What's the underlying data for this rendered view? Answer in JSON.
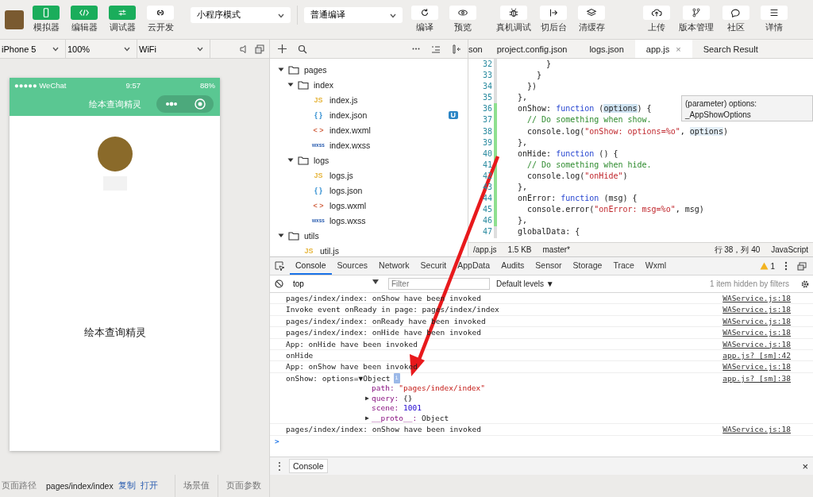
{
  "toolbar": {
    "left_buttons": [
      {
        "label": "模拟器",
        "on": true
      },
      {
        "label": "编辑器",
        "on": true
      },
      {
        "label": "调试器",
        "on": true
      },
      {
        "label": "云开发",
        "on": false
      }
    ],
    "mode_select": {
      "value": "小程序模式"
    },
    "compile_select": {
      "value": "普通编译"
    },
    "actions": [
      {
        "label": "编译"
      },
      {
        "label": "预览"
      },
      {
        "label": "真机调试"
      },
      {
        "label": "切后台"
      },
      {
        "label": "清缓存"
      },
      {
        "label": "上传"
      },
      {
        "label": "版本管理"
      },
      {
        "label": "社区"
      },
      {
        "label": "详情"
      }
    ]
  },
  "device_bar": {
    "device": "iPhone 5",
    "zoom": "100%",
    "network": "WiFi"
  },
  "simulator": {
    "status_bar": {
      "carrier": "●●●●● WeChat",
      "time": "9:57",
      "battery": "88%"
    },
    "nav_title": "绘本查询精灵",
    "page_text": "绘本查询精灵"
  },
  "file_tree": [
    {
      "name": "pages",
      "kind": "folder",
      "expanded": true,
      "children": [
        {
          "name": "index",
          "kind": "folder",
          "expanded": true,
          "children": [
            {
              "name": "index.js",
              "kind": "js",
              "icon_text": "JS"
            },
            {
              "name": "index.json",
              "kind": "json",
              "icon_text": "{ }",
              "badge": "U"
            },
            {
              "name": "index.wxml",
              "kind": "wxml",
              "icon_text": "< >"
            },
            {
              "name": "index.wxss",
              "kind": "wxss",
              "icon_text": "wxss"
            }
          ]
        },
        {
          "name": "logs",
          "kind": "folder",
          "expanded": true,
          "children": [
            {
              "name": "logs.js",
              "kind": "js",
              "icon_text": "JS"
            },
            {
              "name": "logs.json",
              "kind": "json",
              "icon_text": "{ }"
            },
            {
              "name": "logs.wxml",
              "kind": "wxml",
              "icon_text": "< >"
            },
            {
              "name": "logs.wxss",
              "kind": "wxss",
              "icon_text": "wxss"
            }
          ]
        }
      ]
    },
    {
      "name": "utils",
      "kind": "folder",
      "expanded": true,
      "children": [
        {
          "name": "util.js",
          "kind": "js",
          "icon_text": "JS"
        }
      ]
    }
  ],
  "editor": {
    "tabs": [
      {
        "label": "son",
        "selected": false
      },
      {
        "label": "project.config.json",
        "selected": false
      },
      {
        "label": "logs.json",
        "selected": false
      },
      {
        "label": "app.js",
        "selected": true,
        "close": "×"
      },
      {
        "label": "Search Result",
        "selected": false
      }
    ],
    "lines": [
      {
        "number": "32",
        "modified": false,
        "tokens": [
          {
            "text": "      }",
            "kind": "plain"
          }
        ]
      },
      {
        "number": "33",
        "modified": false,
        "tokens": [
          {
            "text": "    }",
            "kind": "plain"
          }
        ]
      },
      {
        "number": "34",
        "modified": false,
        "tokens": [
          {
            "text": "  })",
            "kind": "plain"
          }
        ]
      },
      {
        "number": "35",
        "modified": false,
        "tokens": [
          {
            "text": "},",
            "kind": "plain"
          }
        ]
      },
      {
        "number": "36",
        "modified": true,
        "tokens": [
          {
            "text": "onShow: ",
            "kind": "plain"
          },
          {
            "text": "function",
            "kind": "keyword"
          },
          {
            "text": " (",
            "kind": "plain"
          },
          {
            "text": "options",
            "kind": "match"
          },
          {
            "text": ") {",
            "kind": "plain"
          }
        ]
      },
      {
        "number": "37",
        "modified": true,
        "tokens": [
          {
            "text": "  // Do something when show.",
            "kind": "comment"
          }
        ]
      },
      {
        "number": "38",
        "modified": true,
        "tokens": [
          {
            "text": "  console.log(",
            "kind": "plain"
          },
          {
            "text": "\"onShow: options=%o\"",
            "kind": "string"
          },
          {
            "text": ", ",
            "kind": "plain"
          },
          {
            "text": "options",
            "kind": "hover"
          },
          {
            "text": ")",
            "kind": "plain"
          }
        ]
      },
      {
        "number": "39",
        "modified": true,
        "tokens": [
          {
            "text": "},",
            "kind": "plain"
          }
        ]
      },
      {
        "number": "40",
        "modified": true,
        "tokens": [
          {
            "text": "onHide: ",
            "kind": "plain"
          },
          {
            "text": "function",
            "kind": "keyword"
          },
          {
            "text": " () {",
            "kind": "plain"
          }
        ]
      },
      {
        "number": "41",
        "modified": true,
        "tokens": [
          {
            "text": "  // Do something when hide.",
            "kind": "comment"
          }
        ]
      },
      {
        "number": "42",
        "modified": true,
        "tokens": [
          {
            "text": "  console.log(",
            "kind": "plain"
          },
          {
            "text": "\"onHide\"",
            "kind": "string"
          },
          {
            "text": ")",
            "kind": "plain"
          }
        ]
      },
      {
        "number": "43",
        "modified": true,
        "tokens": [
          {
            "text": "},",
            "kind": "plain"
          }
        ]
      },
      {
        "number": "44",
        "modified": true,
        "tokens": [
          {
            "text": "onError: ",
            "kind": "plain"
          },
          {
            "text": "function",
            "kind": "keyword"
          },
          {
            "text": " (msg) {",
            "kind": "plain"
          }
        ]
      },
      {
        "number": "45",
        "modified": true,
        "tokens": [
          {
            "text": "  console.error(",
            "kind": "plain"
          },
          {
            "text": "\"onError: msg=%o\"",
            "kind": "string"
          },
          {
            "text": ", msg)",
            "kind": "plain"
          }
        ]
      },
      {
        "number": "46",
        "modified": true,
        "tokens": [
          {
            "text": "},",
            "kind": "plain"
          }
        ]
      },
      {
        "number": "47",
        "modified": false,
        "tokens": [
          {
            "text": "globalData: {",
            "kind": "plain"
          }
        ]
      }
    ],
    "tooltip": {
      "line1": "(parameter) options:",
      "line2": "_AppShowOptions"
    },
    "status_bar": {
      "path": "/app.js",
      "size": "1.5 KB",
      "branch": "master*",
      "position": "行 38，列 40",
      "language": "JavaScript"
    }
  },
  "devtools": {
    "tabs": [
      {
        "label": "Console",
        "selected": true
      },
      {
        "label": "Sources",
        "selected": false
      },
      {
        "label": "Network",
        "selected": false
      },
      {
        "label": "Securit",
        "selected": false
      },
      {
        "label": "AppData",
        "selected": false
      },
      {
        "label": "Audits",
        "selected": false
      },
      {
        "label": "Sensor",
        "selected": false
      },
      {
        "label": "Storage",
        "selected": false
      },
      {
        "label": "Trace",
        "selected": false
      },
      {
        "label": "Wxml",
        "selected": false
      }
    ],
    "warnings": "1",
    "context": "top",
    "filter_placeholder": "Filter",
    "levels": "Default levels ▼",
    "hidden_note": "1 item hidden by filters",
    "logs": [
      {
        "kind": "text",
        "text": "pages/index/index: onShow have been invoked",
        "source": "WAService.js:18"
      },
      {
        "kind": "text",
        "text": "Invoke event onReady in page: pages/index/index",
        "source": "WAService.js:18"
      },
      {
        "kind": "text",
        "text": "pages/index/index: onReady have been invoked",
        "source": "WAService.js:18"
      },
      {
        "kind": "text",
        "text": "pages/index/index: onHide have been invoked",
        "source": "WAService.js:18"
      },
      {
        "kind": "text",
        "text": "App: onHide have been invoked",
        "source": "WAService.js:18"
      },
      {
        "kind": "text",
        "text": "onHide",
        "source": "app.js? [sm]:42"
      },
      {
        "kind": "text",
        "text": "App: onShow have been invoked",
        "source": "WAService.js:18"
      },
      {
        "kind": "object",
        "text": "onShow: options=",
        "toggle": "▼",
        "expanded": true,
        "summary": "Object",
        "info": "i",
        "source": "app.js? [sm]:38",
        "properties": [
          {
            "key": "path:",
            "value": "\"pages/index/index\"",
            "kind": "string"
          },
          {
            "key": "query:",
            "value": "{}",
            "kind": "plain",
            "toggle": "▶"
          },
          {
            "key": "scene:",
            "value": "1001",
            "kind": "number"
          },
          {
            "key": "__proto__:",
            "value": "Object",
            "kind": "plain",
            "toggle": "▶"
          }
        ]
      },
      {
        "kind": "text",
        "text": "pages/index/index: onShow have been invoked",
        "source": "WAService.js:18"
      }
    ],
    "prompt": ">",
    "drawer": {
      "menu": "⋮",
      "tab": "Console",
      "close": "×"
    }
  },
  "footer": {
    "path_label": "页面路径",
    "path": "pages/index/index",
    "copy": "复制",
    "open": "打开",
    "scene_label": "场景值",
    "params_label": "页面参数"
  }
}
